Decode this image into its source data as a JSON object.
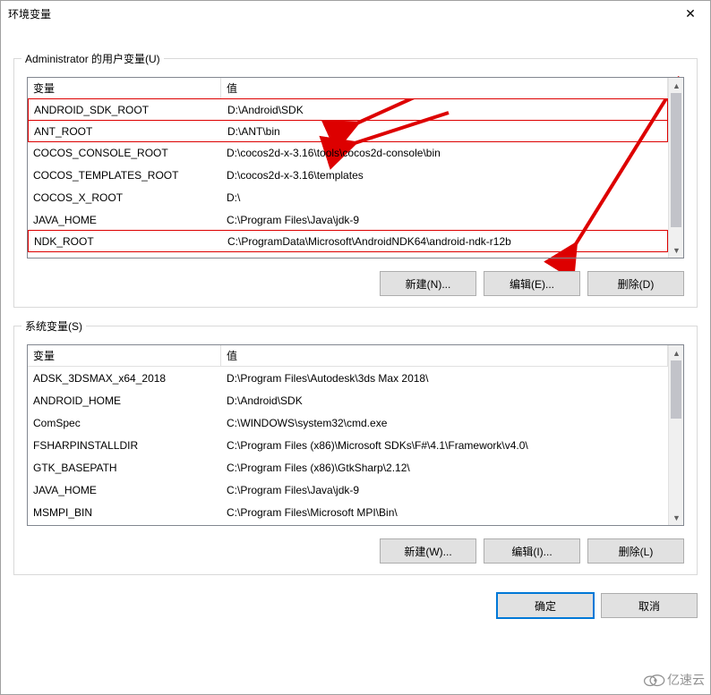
{
  "window": {
    "title": "环境变量"
  },
  "user_section": {
    "legend": "Administrator 的用户变量(U)",
    "headers": {
      "var": "变量",
      "val": "值"
    },
    "rows": [
      {
        "var": "ANDROID_SDK_ROOT",
        "val": "D:\\Android\\SDK",
        "hl": true
      },
      {
        "var": "ANT_ROOT",
        "val": "D:\\ANT\\bin",
        "hl": true
      },
      {
        "var": "COCOS_CONSOLE_ROOT",
        "val": "D:\\cocos2d-x-3.16\\tools\\cocos2d-console\\bin",
        "hl": false
      },
      {
        "var": "COCOS_TEMPLATES_ROOT",
        "val": "D:\\cocos2d-x-3.16\\templates",
        "hl": false
      },
      {
        "var": "COCOS_X_ROOT",
        "val": "D:\\",
        "hl": false
      },
      {
        "var": "JAVA_HOME",
        "val": "C:\\Program Files\\Java\\jdk-9",
        "hl": false
      },
      {
        "var": "NDK_ROOT",
        "val": "C:\\ProgramData\\Microsoft\\AndroidNDK64\\android-ndk-r12b",
        "hl": true
      }
    ],
    "buttons": {
      "new": "新建(N)...",
      "edit": "编辑(E)...",
      "delete": "删除(D)"
    }
  },
  "sys_section": {
    "legend": "系统变量(S)",
    "headers": {
      "var": "变量",
      "val": "值"
    },
    "rows": [
      {
        "var": "ADSK_3DSMAX_x64_2018",
        "val": "D:\\Program Files\\Autodesk\\3ds Max 2018\\"
      },
      {
        "var": "ANDROID_HOME",
        "val": "D:\\Android\\SDK"
      },
      {
        "var": "ComSpec",
        "val": "C:\\WINDOWS\\system32\\cmd.exe"
      },
      {
        "var": "FSHARPINSTALLDIR",
        "val": "C:\\Program Files (x86)\\Microsoft SDKs\\F#\\4.1\\Framework\\v4.0\\"
      },
      {
        "var": "GTK_BASEPATH",
        "val": "C:\\Program Files (x86)\\GtkSharp\\2.12\\"
      },
      {
        "var": "JAVA_HOME",
        "val": "C:\\Program Files\\Java\\jdk-9"
      },
      {
        "var": "MSMPI_BIN",
        "val": "C:\\Program Files\\Microsoft MPI\\Bin\\"
      }
    ],
    "buttons": {
      "new": "新建(W)...",
      "edit": "编辑(I)...",
      "delete": "删除(L)"
    }
  },
  "bottom": {
    "ok": "确定",
    "cancel": "取消"
  },
  "watermark": "亿速云"
}
